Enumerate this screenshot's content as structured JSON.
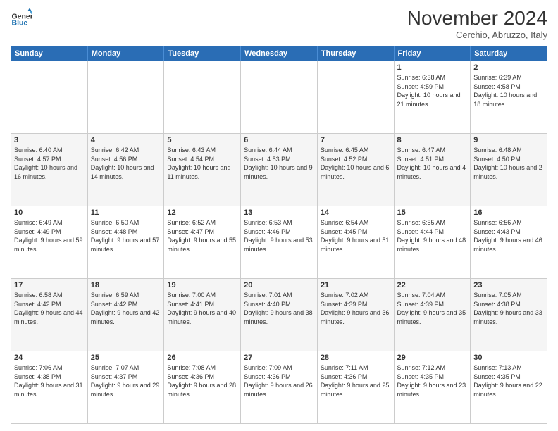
{
  "header": {
    "logo": {
      "general": "General",
      "blue": "Blue"
    },
    "title": "November 2024",
    "location": "Cerchio, Abruzzo, Italy"
  },
  "weekdays": [
    "Sunday",
    "Monday",
    "Tuesday",
    "Wednesday",
    "Thursday",
    "Friday",
    "Saturday"
  ],
  "weeks": [
    [
      {
        "day": "",
        "info": ""
      },
      {
        "day": "",
        "info": ""
      },
      {
        "day": "",
        "info": ""
      },
      {
        "day": "",
        "info": ""
      },
      {
        "day": "",
        "info": ""
      },
      {
        "day": "1",
        "info": "Sunrise: 6:38 AM\nSunset: 4:59 PM\nDaylight: 10 hours and 21 minutes."
      },
      {
        "day": "2",
        "info": "Sunrise: 6:39 AM\nSunset: 4:58 PM\nDaylight: 10 hours and 18 minutes."
      }
    ],
    [
      {
        "day": "3",
        "info": "Sunrise: 6:40 AM\nSunset: 4:57 PM\nDaylight: 10 hours and 16 minutes."
      },
      {
        "day": "4",
        "info": "Sunrise: 6:42 AM\nSunset: 4:56 PM\nDaylight: 10 hours and 14 minutes."
      },
      {
        "day": "5",
        "info": "Sunrise: 6:43 AM\nSunset: 4:54 PM\nDaylight: 10 hours and 11 minutes."
      },
      {
        "day": "6",
        "info": "Sunrise: 6:44 AM\nSunset: 4:53 PM\nDaylight: 10 hours and 9 minutes."
      },
      {
        "day": "7",
        "info": "Sunrise: 6:45 AM\nSunset: 4:52 PM\nDaylight: 10 hours and 6 minutes."
      },
      {
        "day": "8",
        "info": "Sunrise: 6:47 AM\nSunset: 4:51 PM\nDaylight: 10 hours and 4 minutes."
      },
      {
        "day": "9",
        "info": "Sunrise: 6:48 AM\nSunset: 4:50 PM\nDaylight: 10 hours and 2 minutes."
      }
    ],
    [
      {
        "day": "10",
        "info": "Sunrise: 6:49 AM\nSunset: 4:49 PM\nDaylight: 9 hours and 59 minutes."
      },
      {
        "day": "11",
        "info": "Sunrise: 6:50 AM\nSunset: 4:48 PM\nDaylight: 9 hours and 57 minutes."
      },
      {
        "day": "12",
        "info": "Sunrise: 6:52 AM\nSunset: 4:47 PM\nDaylight: 9 hours and 55 minutes."
      },
      {
        "day": "13",
        "info": "Sunrise: 6:53 AM\nSunset: 4:46 PM\nDaylight: 9 hours and 53 minutes."
      },
      {
        "day": "14",
        "info": "Sunrise: 6:54 AM\nSunset: 4:45 PM\nDaylight: 9 hours and 51 minutes."
      },
      {
        "day": "15",
        "info": "Sunrise: 6:55 AM\nSunset: 4:44 PM\nDaylight: 9 hours and 48 minutes."
      },
      {
        "day": "16",
        "info": "Sunrise: 6:56 AM\nSunset: 4:43 PM\nDaylight: 9 hours and 46 minutes."
      }
    ],
    [
      {
        "day": "17",
        "info": "Sunrise: 6:58 AM\nSunset: 4:42 PM\nDaylight: 9 hours and 44 minutes."
      },
      {
        "day": "18",
        "info": "Sunrise: 6:59 AM\nSunset: 4:42 PM\nDaylight: 9 hours and 42 minutes."
      },
      {
        "day": "19",
        "info": "Sunrise: 7:00 AM\nSunset: 4:41 PM\nDaylight: 9 hours and 40 minutes."
      },
      {
        "day": "20",
        "info": "Sunrise: 7:01 AM\nSunset: 4:40 PM\nDaylight: 9 hours and 38 minutes."
      },
      {
        "day": "21",
        "info": "Sunrise: 7:02 AM\nSunset: 4:39 PM\nDaylight: 9 hours and 36 minutes."
      },
      {
        "day": "22",
        "info": "Sunrise: 7:04 AM\nSunset: 4:39 PM\nDaylight: 9 hours and 35 minutes."
      },
      {
        "day": "23",
        "info": "Sunrise: 7:05 AM\nSunset: 4:38 PM\nDaylight: 9 hours and 33 minutes."
      }
    ],
    [
      {
        "day": "24",
        "info": "Sunrise: 7:06 AM\nSunset: 4:38 PM\nDaylight: 9 hours and 31 minutes."
      },
      {
        "day": "25",
        "info": "Sunrise: 7:07 AM\nSunset: 4:37 PM\nDaylight: 9 hours and 29 minutes."
      },
      {
        "day": "26",
        "info": "Sunrise: 7:08 AM\nSunset: 4:36 PM\nDaylight: 9 hours and 28 minutes."
      },
      {
        "day": "27",
        "info": "Sunrise: 7:09 AM\nSunset: 4:36 PM\nDaylight: 9 hours and 26 minutes."
      },
      {
        "day": "28",
        "info": "Sunrise: 7:11 AM\nSunset: 4:36 PM\nDaylight: 9 hours and 25 minutes."
      },
      {
        "day": "29",
        "info": "Sunrise: 7:12 AM\nSunset: 4:35 PM\nDaylight: 9 hours and 23 minutes."
      },
      {
        "day": "30",
        "info": "Sunrise: 7:13 AM\nSunset: 4:35 PM\nDaylight: 9 hours and 22 minutes."
      }
    ]
  ]
}
